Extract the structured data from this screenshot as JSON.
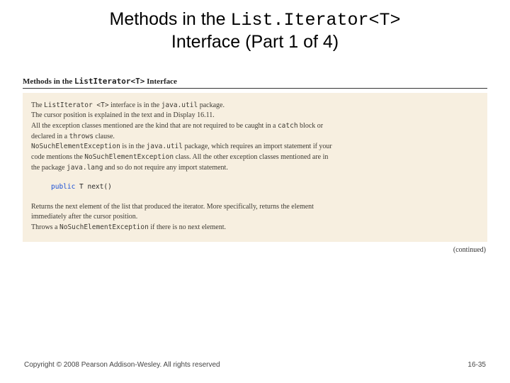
{
  "title": {
    "pre": "Methods in the ",
    "mono": "List.Iterator<T>",
    "line2": "Interface (Part 1 of 4)"
  },
  "figureHeader": {
    "pre": "Methods in the ",
    "mono": "ListIterator<T>",
    "post": " Interface"
  },
  "intro": {
    "l1a": "The ",
    "l1b": "ListIterator <T>",
    "l1c": " interface is in the ",
    "l1d": "java.util",
    "l1e": " package.",
    "l2": "The cursor position is explained in the text and in Display 16.11.",
    "l3a": "All the exception classes mentioned are the kind that are not required to be caught in a ",
    "l3b": "catch",
    "l3c": " block or",
    "l4a": "declared in a ",
    "l4b": "throws",
    "l4c": " clause.",
    "l5a": "NoSuchElementException",
    "l5b": " is in the ",
    "l5c": "java.util",
    "l5d": " package, which requires an import statement if your",
    "l6a": "code mentions the ",
    "l6b": "NoSuchElementException",
    "l6c": " class. All the other exception classes mentioned are in",
    "l7a": "the package ",
    "l7b": "java.lang",
    "l7c": " and so do not require any import statement."
  },
  "signature": {
    "kw": "public",
    "rest": " T next()"
  },
  "desc": {
    "l1": "Returns the next element of the list that produced the iterator. More specifically, returns the element",
    "l2": "immediately after the cursor position.",
    "l3a": "Throws a ",
    "l3b": "NoSuchElementException",
    "l3c": " if there is no next element."
  },
  "continued": "(continued)",
  "footer": {
    "copyright": "Copyright © 2008 Pearson Addison-Wesley. All rights reserved",
    "pageno": "16-35"
  }
}
